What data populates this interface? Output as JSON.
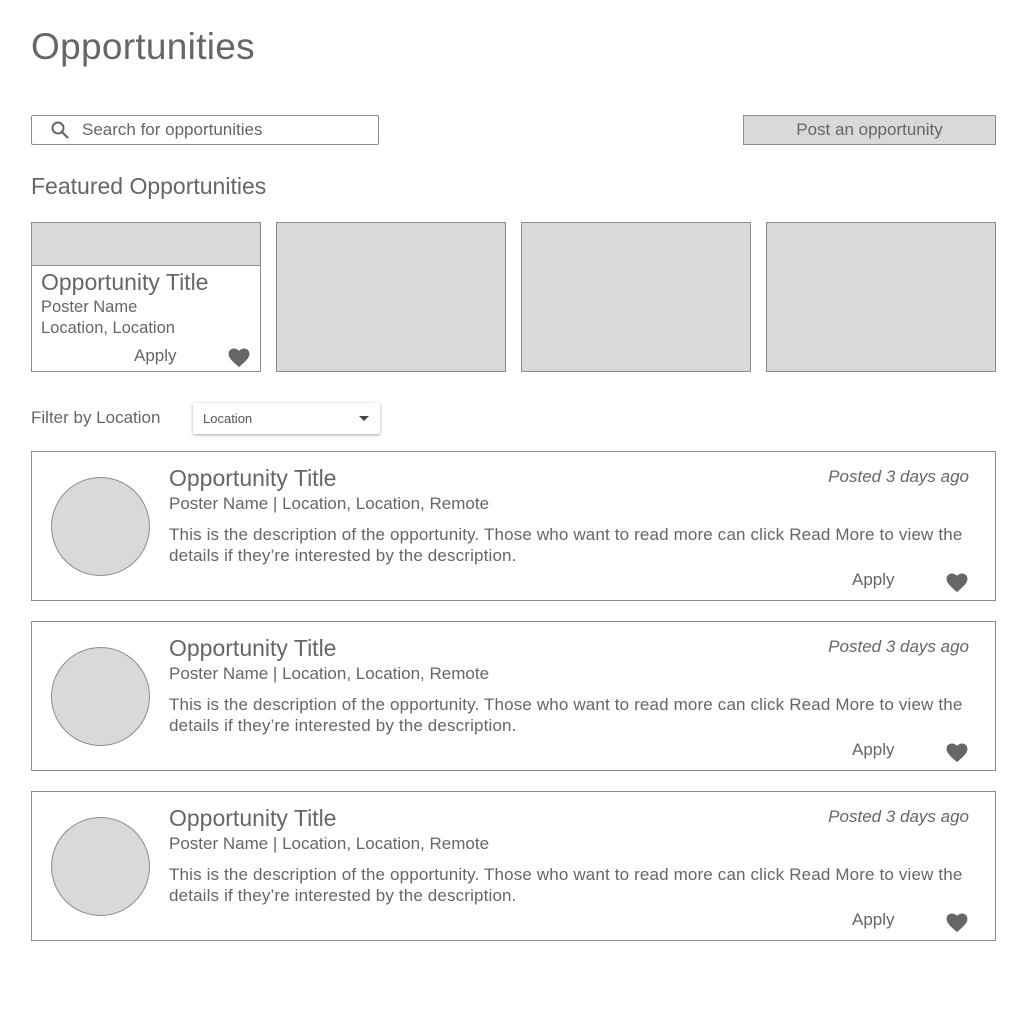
{
  "header": {
    "title": "Opportunities"
  },
  "search": {
    "placeholder": "Search for opportunities"
  },
  "actions": {
    "post_label": "Post an opportunity"
  },
  "featured": {
    "section_title": "Featured Opportunities",
    "card": {
      "title": "Opportunity Title",
      "poster": "Poster Name",
      "location": "Location, Location",
      "apply_label": "Apply"
    }
  },
  "filter": {
    "label": "Filter by Location",
    "selected": "Location"
  },
  "listings": [
    {
      "title": "Opportunity Title",
      "meta": "Poster Name | Location, Location, Remote",
      "posted": "Posted 3 days ago",
      "description": "This is the description of the opportunity. Those who want to read more can click Read More to view the details if they’re interested by the description.",
      "apply_label": "Apply"
    },
    {
      "title": "Opportunity Title",
      "meta": "Poster Name | Location, Location, Remote",
      "posted": "Posted 3 days ago",
      "description": "This is the description of the opportunity. Those who want to read more can click Read More to view the details if they’re interested by the description.",
      "apply_label": "Apply"
    },
    {
      "title": "Opportunity Title",
      "meta": "Poster Name | Location, Location, Remote",
      "posted": "Posted 3 days ago",
      "description": "This is the description of the opportunity. Those who want to read more can click Read More to view the details if they’re interested by the description.",
      "apply_label": "Apply"
    }
  ],
  "colors": {
    "text": "#666666",
    "placeholder_fill": "#d9d9d9",
    "border": "#8c8c8c",
    "heart": "#666666"
  },
  "icons": {
    "search": "search-icon",
    "favorite": "heart-icon",
    "dropdown": "caret-down-icon"
  }
}
